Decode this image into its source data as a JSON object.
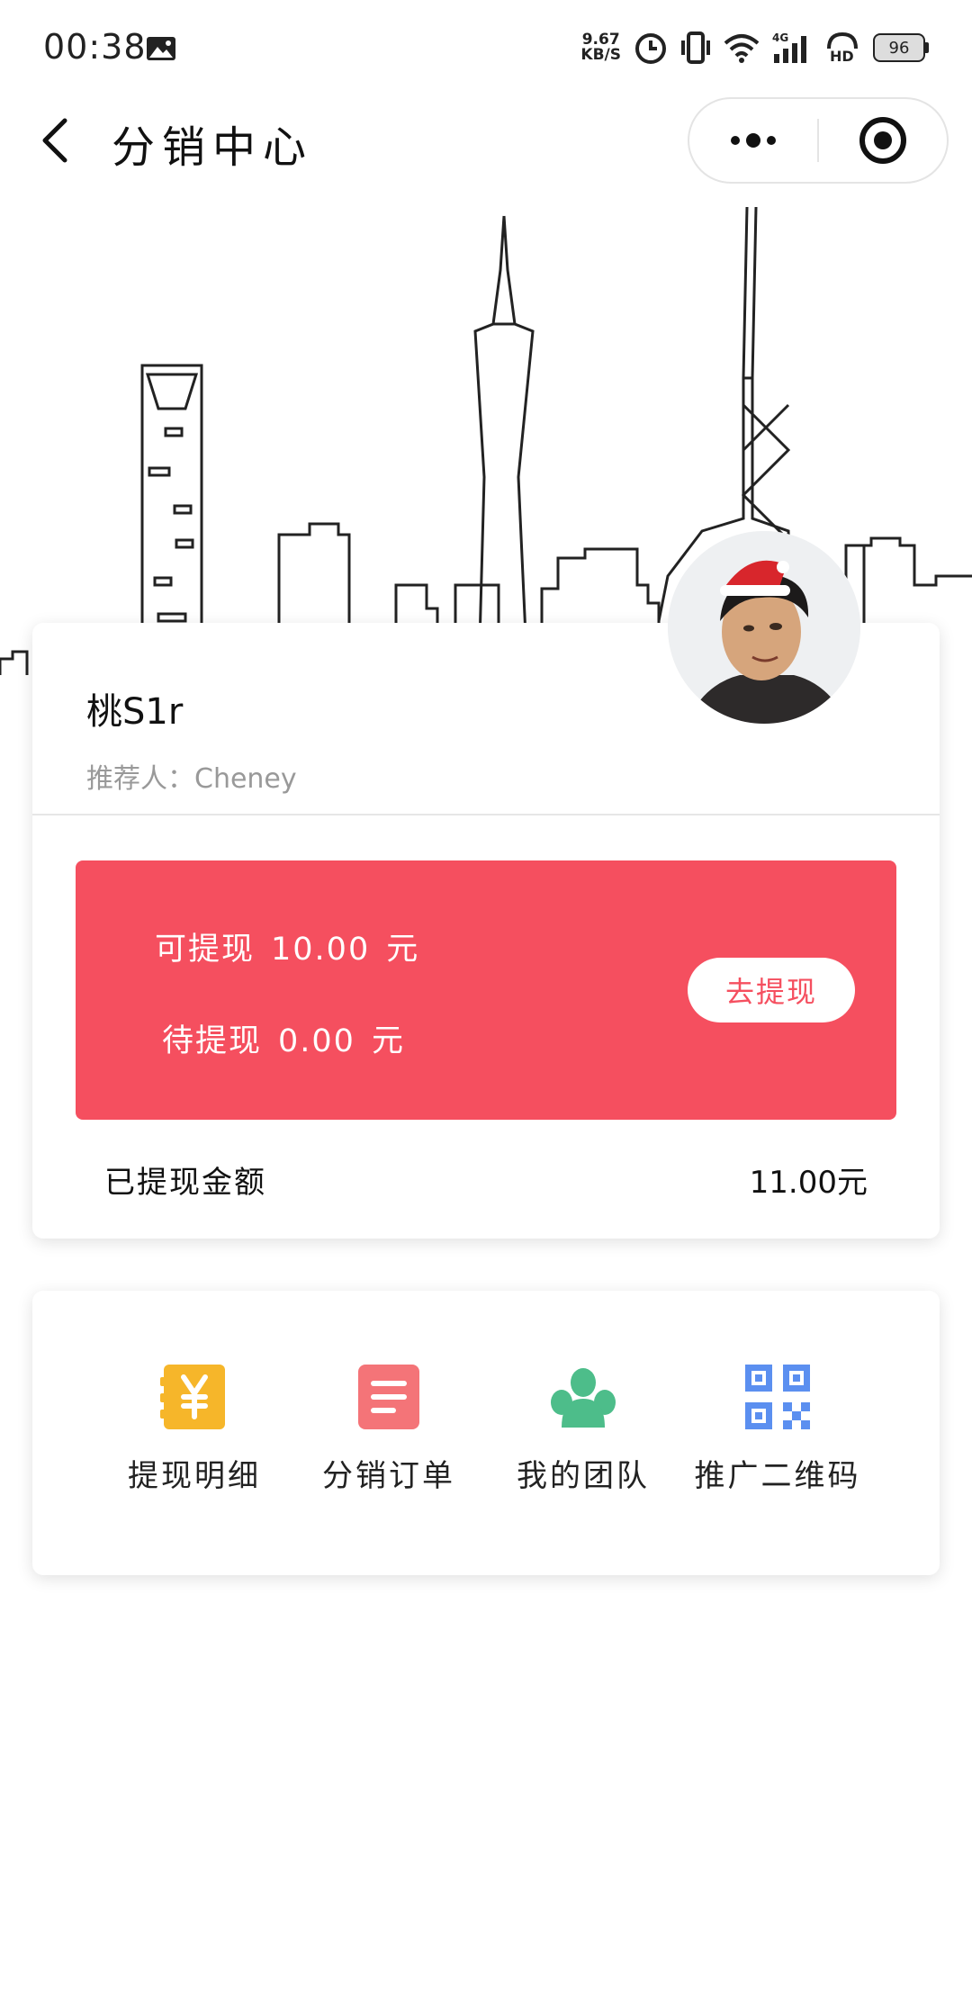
{
  "status_bar": {
    "time": "00:38",
    "net_speed_value": "9.67",
    "net_speed_unit": "KB/S",
    "battery": "96"
  },
  "nav": {
    "title": "分销中心"
  },
  "user": {
    "name": "桃S1r",
    "referrer_label": "推荐人：",
    "referrer_name": "Cheney"
  },
  "balance": {
    "available_label": "可提现",
    "available_amount": "10.00",
    "available_unit": "元",
    "pending_label": "待提现",
    "pending_amount": "0.00",
    "pending_unit": "元",
    "withdraw_button": "去提现",
    "withdrawn_label": "已提现金额",
    "withdrawn_amount": "11.00元"
  },
  "menu": [
    {
      "label": "提现明细",
      "icon": "yen-wallet-icon",
      "color": "#f6b62a"
    },
    {
      "label": "分销订单",
      "icon": "order-list-icon",
      "color": "#f47478"
    },
    {
      "label": "我的团队",
      "icon": "team-icon",
      "color": "#4dbd8a"
    },
    {
      "label": "推广二维码",
      "icon": "qr-code-icon",
      "color": "#5b8ff0"
    }
  ],
  "colors": {
    "accent": "#f54f5f"
  }
}
